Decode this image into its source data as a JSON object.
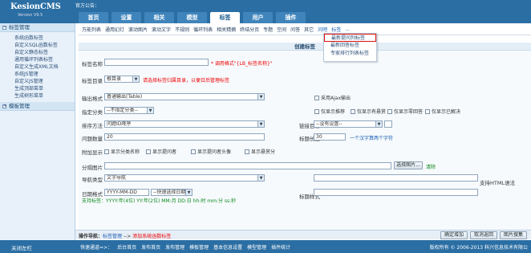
{
  "app": {
    "name": "KesionCMS",
    "version": "Version V9.5",
    "notice": "官方公告："
  },
  "tabs": [
    "首页",
    "设置",
    "相关",
    "模型",
    "标签",
    "用户",
    "插件"
  ],
  "sidebar": {
    "section1": "标签管理",
    "items": [
      "系统函数标签",
      "自定义SQL函数标签",
      "自定义静态标签",
      "通用循环列表标签",
      "自定义生成XML文档",
      "系统JS管理",
      "自定义JS管理",
      "生成顶部菜单",
      "生成树形菜单"
    ],
    "section2": "模板管理"
  },
  "toolbar": {
    "items": [
      "万能列表",
      "通用幻灯",
      "滚动图片",
      "滚动文字",
      "不规则",
      "循环列表",
      "相关精摘",
      "终结分页",
      "专题",
      "空间",
      "问答",
      "其它",
      "问吧",
      "标签",
      "..."
    ]
  },
  "dropdown": {
    "items": [
      "最新提问列标签",
      "最新回答标签",
      "专家排行列表标签"
    ]
  },
  "form": {
    "title": "创建标签",
    "tag_name_label": "标签名称",
    "tag_name_hint": "* 调用格式\"{LB_标签名称}\"",
    "tag_dir_label": "标签目录",
    "tag_dir_value": "根目录",
    "tag_dir_hint": "请选择标签归属目录，以便日后管理标签",
    "output_label": "输出格式",
    "output_value": "普通输出(Table)",
    "ajax_label": "采用Ajax输出",
    "category_label": "指定分类",
    "category_value": "--不指定分类--",
    "chk_recommend": "仅显示推荐",
    "chk_reward": "仅显示有悬赏",
    "chk_answered": "仅显示零回答",
    "chk_solved": "仅显示已解决",
    "sort_label": "排序方法",
    "sort_value": "问题ID降序",
    "link_target_label": "链接目标",
    "link_target_value": "--没有设置--",
    "count_label": "问题数量",
    "count_value": "20",
    "title_len_label": "标题长度",
    "title_len_value": "30",
    "title_len_hint": "一个汉字算两个字符",
    "extra_label": "附加显示",
    "chk_category_name": "显示分类名称",
    "chk_asker": "显示提问者",
    "chk_avatar": "显示提问者头像",
    "chk_reward_points": "显示悬赏分",
    "sep_img_label": "分隔图片",
    "select_img_btn": "选择图片...",
    "clear_link": "清除",
    "nav_type_label": "导航类型",
    "nav_type_value": "文字导航",
    "html_support": "支持HTML语法",
    "date_label": "日期格式",
    "date_value": "YYYY-MM-DD",
    "date_quick": "--快速选择日期--",
    "date_hint": "支持标签：YYYY:年(4位) YY:年(2位) MM:月 DD:日 hh:时 mm:分 ss:秒",
    "title_style_label": "标题样式"
  },
  "statusbar": {
    "prefix": "操作导航：",
    "crumb1": "标签管理",
    "sep": "-->",
    "crumb2": "添加系统函数标签"
  },
  "footer": {
    "left": "关闭左栏",
    "quick_label": "快速通道=>：",
    "quick": [
      "后台首页",
      "发布首页",
      "发布管理",
      "模板管理",
      "基本信息设置",
      "模型管理",
      "插件统计"
    ],
    "copyright": "版权所有 © 2006-2013 科兴信息技术有限公"
  },
  "buttons": [
    "确定增加",
    "取消返回",
    "图片搜集"
  ]
}
